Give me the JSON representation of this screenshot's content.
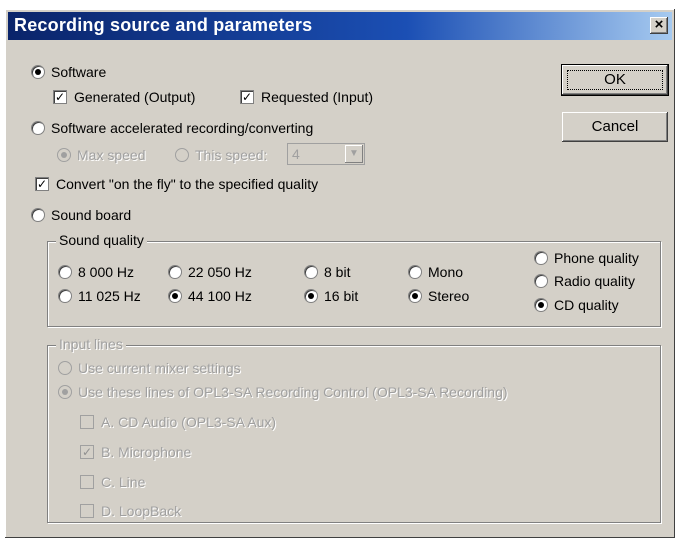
{
  "window": {
    "title": "Recording source and parameters",
    "close_glyph": "×"
  },
  "buttons": {
    "ok": "OK",
    "cancel": "Cancel"
  },
  "software": {
    "label": "Software",
    "generated": "Generated (Output)",
    "requested": "Requested (Input)"
  },
  "accelerated": {
    "label": "Software accelerated recording/converting",
    "max_speed": "Max speed",
    "this_speed": "This speed:",
    "speed_value": "4",
    "convert": "Convert \"on the fly\" to the specified quality"
  },
  "soundboard": {
    "label": "Sound board"
  },
  "sound_quality": {
    "title": "Sound quality",
    "rates": [
      "8 000 Hz",
      "22 050 Hz",
      "11 025 Hz",
      "44 100 Hz"
    ],
    "bits": [
      "8 bit",
      "16 bit"
    ],
    "channels": [
      "Mono",
      "Stereo"
    ],
    "presets": [
      "Phone quality",
      "Radio quality",
      "CD quality"
    ]
  },
  "input_lines": {
    "title": "Input lines",
    "use_current": "Use current mixer settings",
    "use_these": "Use these lines of OPL3-SA Recording Control (OPL3-SA Recording)",
    "lines": [
      "A. CD Audio (OPL3-SA Aux)",
      "B. Microphone",
      "C. Line",
      "D. LoopBack"
    ]
  }
}
